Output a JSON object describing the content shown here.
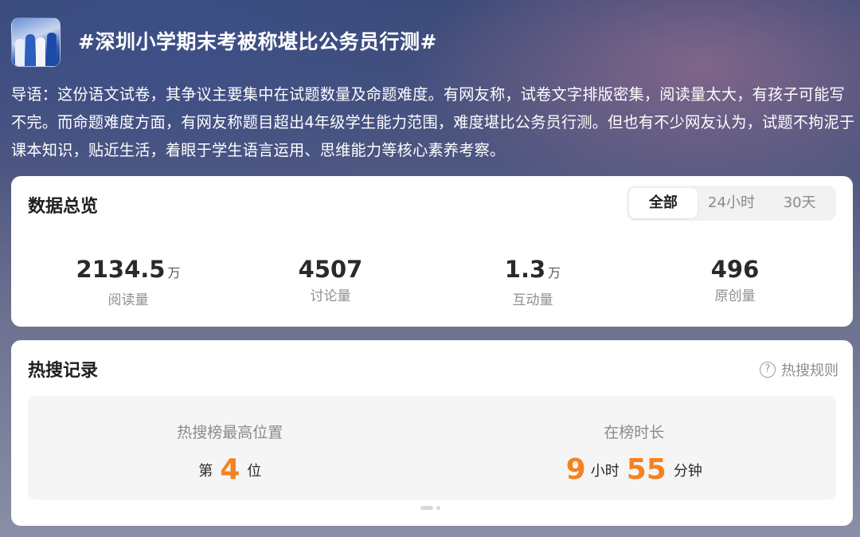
{
  "topic": {
    "title": "#深圳小学期末考被称堪比公务员行测#",
    "thumbnail_icon": "topic-photo-thumbnail"
  },
  "intro": "导语：这份语文试卷，其争议主要集中在试题数量及命题难度。有网友称，试卷文字排版密集，阅读量太大，有孩子可能写不完。而命题难度方面，有网友称题目超出4年级学生能力范围，难度堪比公务员行测。但也有不少网友认为，试题不拘泥于课本知识，贴近生活，着眼于学生语言运用、思维能力等核心素养考察。",
  "overview": {
    "title": "数据总览",
    "tabs": [
      {
        "label": "全部",
        "active": true
      },
      {
        "label": "24小时",
        "active": false
      },
      {
        "label": "30天",
        "active": false
      }
    ],
    "stats": [
      {
        "value": "2134.5",
        "unit": "万",
        "label": "阅读量"
      },
      {
        "value": "4507",
        "unit": "",
        "label": "讨论量"
      },
      {
        "value": "1.3",
        "unit": "万",
        "label": "互动量"
      },
      {
        "value": "496",
        "unit": "",
        "label": "原创量"
      }
    ]
  },
  "hot": {
    "title": "热搜记录",
    "rules_label": "热搜规则",
    "rules_icon": "question-circle-icon",
    "peak": {
      "label": "热搜榜最高位置",
      "prefix": "第",
      "value": "4",
      "suffix": "位"
    },
    "duration": {
      "label": "在榜时长",
      "hours": "9",
      "hours_unit": "小时",
      "minutes": "55",
      "minutes_unit": "分钟"
    }
  },
  "colors": {
    "accent_orange": "#f5821f",
    "card_bg": "#ffffff",
    "muted_text": "#8a8a8a"
  }
}
